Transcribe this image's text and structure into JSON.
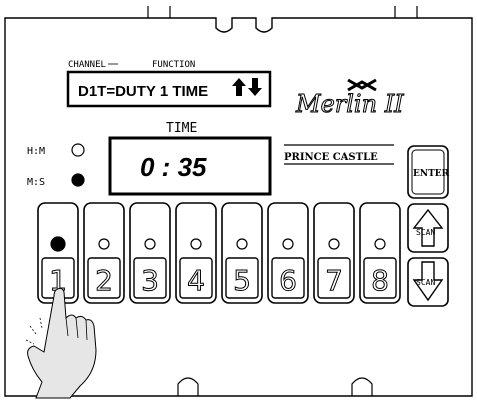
{
  "channel_label": "CHANNEL",
  "function_label": "FUNCTION",
  "function_display": "D1T=DUTY 1 TIME",
  "brand_logo": "Merlin II",
  "maker_label": "PRINCE CASTLE",
  "time_label": "TIME",
  "time_display": "0 : 35",
  "hm_label": "H:M",
  "ms_label": "M:S",
  "enter_label": "ENTER",
  "scan_label": "SCAN",
  "channels": [
    {
      "label": "1",
      "led_on": true
    },
    {
      "label": "2",
      "led_on": false
    },
    {
      "label": "3",
      "led_on": false
    },
    {
      "label": "4",
      "led_on": false
    },
    {
      "label": "5",
      "led_on": false
    },
    {
      "label": "6",
      "led_on": false
    },
    {
      "label": "7",
      "led_on": false
    },
    {
      "label": "8",
      "led_on": false
    }
  ],
  "hm_led_on": false,
  "ms_led_on": true,
  "icons": [
    "up-down-arrows-icon",
    "scan-up-arrow-icon",
    "scan-down-arrow-icon",
    "pointing-hand-icon",
    "merlin-crest-icon"
  ]
}
